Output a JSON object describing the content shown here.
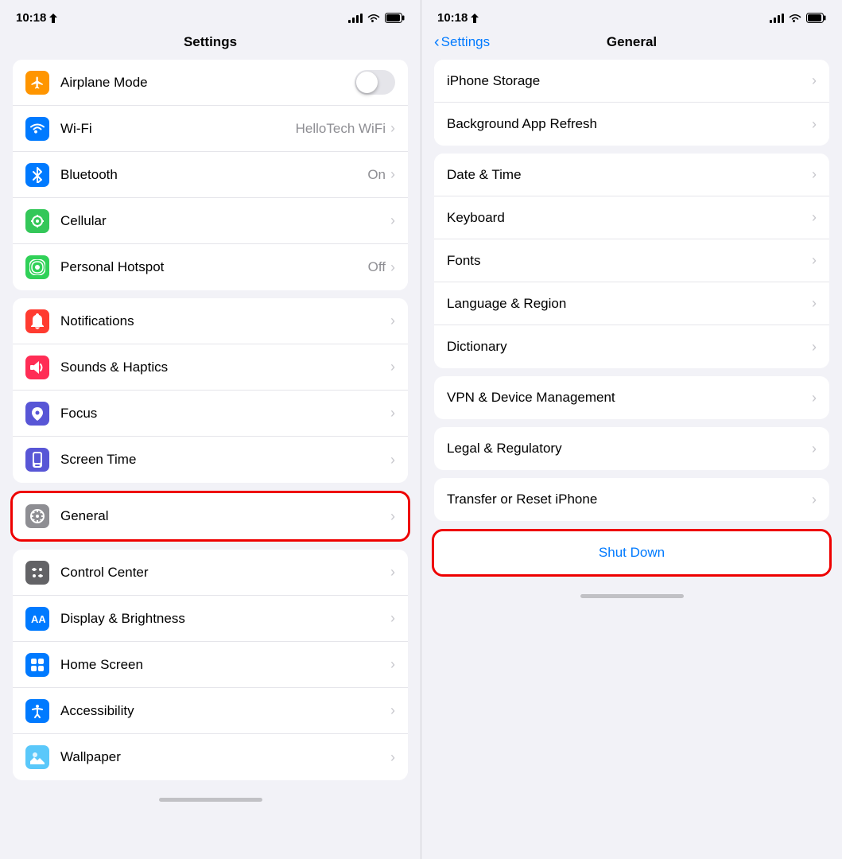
{
  "left": {
    "statusBar": {
      "time": "10:18",
      "locationIcon": "›",
      "batteryFull": true
    },
    "title": "Settings",
    "group1": {
      "rows": [
        {
          "id": "airplane-mode",
          "label": "Airplane Mode",
          "icon": "airplane",
          "iconColor": "orange",
          "type": "toggle",
          "toggleOn": false
        },
        {
          "id": "wifi",
          "label": "Wi-Fi",
          "icon": "wifi",
          "iconColor": "blue",
          "type": "value",
          "value": "HelloTech WiFi"
        },
        {
          "id": "bluetooth",
          "label": "Bluetooth",
          "icon": "bluetooth",
          "iconColor": "blue",
          "type": "value",
          "value": "On"
        },
        {
          "id": "cellular",
          "label": "Cellular",
          "icon": "cellular",
          "iconColor": "green",
          "type": "chevron"
        },
        {
          "id": "personal-hotspot",
          "label": "Personal Hotspot",
          "icon": "hotspot",
          "iconColor": "green-teal",
          "type": "value",
          "value": "Off"
        }
      ]
    },
    "group2": {
      "rows": [
        {
          "id": "notifications",
          "label": "Notifications",
          "icon": "bell",
          "iconColor": "red",
          "type": "chevron"
        },
        {
          "id": "sounds-haptics",
          "label": "Sounds & Haptics",
          "icon": "sound",
          "iconColor": "pink",
          "type": "chevron"
        },
        {
          "id": "focus",
          "label": "Focus",
          "icon": "moon",
          "iconColor": "indigo",
          "type": "chevron"
        },
        {
          "id": "screen-time",
          "label": "Screen Time",
          "icon": "hourglass",
          "iconColor": "indigo",
          "type": "chevron"
        }
      ]
    },
    "generalHighlight": {
      "row": {
        "id": "general",
        "label": "General",
        "icon": "gear",
        "iconColor": "gray",
        "type": "chevron"
      }
    },
    "group3": {
      "rows": [
        {
          "id": "control-center",
          "label": "Control Center",
          "icon": "sliders",
          "iconColor": "gray2",
          "type": "chevron"
        },
        {
          "id": "display-brightness",
          "label": "Display & Brightness",
          "icon": "aa",
          "iconColor": "aa",
          "type": "chevron"
        },
        {
          "id": "home-screen",
          "label": "Home Screen",
          "icon": "homescreen",
          "iconColor": "homescreen",
          "type": "chevron"
        },
        {
          "id": "accessibility",
          "label": "Accessibility",
          "icon": "accessibility",
          "iconColor": "accessibility",
          "type": "chevron"
        },
        {
          "id": "wallpaper",
          "label": "Wallpaper",
          "icon": "wallpaper",
          "iconColor": "teal",
          "type": "chevron"
        }
      ]
    }
  },
  "right": {
    "statusBar": {
      "time": "10:18"
    },
    "backLabel": "Settings",
    "title": "General",
    "group1": {
      "rows": [
        {
          "id": "iphone-storage",
          "label": "iPhone Storage",
          "type": "chevron"
        },
        {
          "id": "background-refresh",
          "label": "Background App Refresh",
          "type": "chevron"
        }
      ]
    },
    "group2": {
      "rows": [
        {
          "id": "date-time",
          "label": "Date & Time",
          "type": "chevron"
        },
        {
          "id": "keyboard",
          "label": "Keyboard",
          "type": "chevron"
        },
        {
          "id": "fonts",
          "label": "Fonts",
          "type": "chevron"
        },
        {
          "id": "language-region",
          "label": "Language & Region",
          "type": "chevron"
        },
        {
          "id": "dictionary",
          "label": "Dictionary",
          "type": "chevron"
        }
      ]
    },
    "group3": {
      "rows": [
        {
          "id": "vpn-management",
          "label": "VPN & Device Management",
          "type": "chevron"
        }
      ]
    },
    "group4": {
      "rows": [
        {
          "id": "legal-regulatory",
          "label": "Legal & Regulatory",
          "type": "chevron"
        }
      ]
    },
    "group5": {
      "rows": [
        {
          "id": "transfer-reset",
          "label": "Transfer or Reset iPhone",
          "type": "chevron"
        }
      ]
    },
    "shutdownHighlight": {
      "label": "Shut Down"
    }
  }
}
